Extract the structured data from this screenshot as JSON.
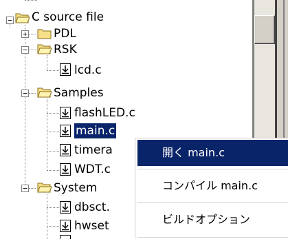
{
  "tree": {
    "root": {
      "label": "C source file",
      "expander": "−"
    },
    "pdl": {
      "label": "PDL",
      "expander": "+"
    },
    "rsk": {
      "label": "RSK",
      "expander": "−"
    },
    "rsk_files": [
      "lcd.c"
    ],
    "samples": {
      "label": "Samples",
      "expander": "−"
    },
    "samples_files": [
      "flashLED.c",
      "main.c",
      "timera",
      "WDT.c"
    ],
    "system": {
      "label": "System",
      "expander": "−"
    },
    "system_files": [
      "dbsct.",
      "hwset"
    ]
  },
  "context_menu": {
    "items": [
      {
        "label": "開く main.c"
      },
      {
        "label": "コンパイル main.c"
      },
      {
        "label": "ビルドオプション"
      }
    ]
  },
  "colors": {
    "selection": "#0a246a",
    "folder_fill": "#f7e08a",
    "scrollbar_face": "#d4d0c8"
  },
  "icons": {
    "folder": "folder-icon",
    "file": "c-file-icon",
    "expander": "tree-expander-icon"
  }
}
